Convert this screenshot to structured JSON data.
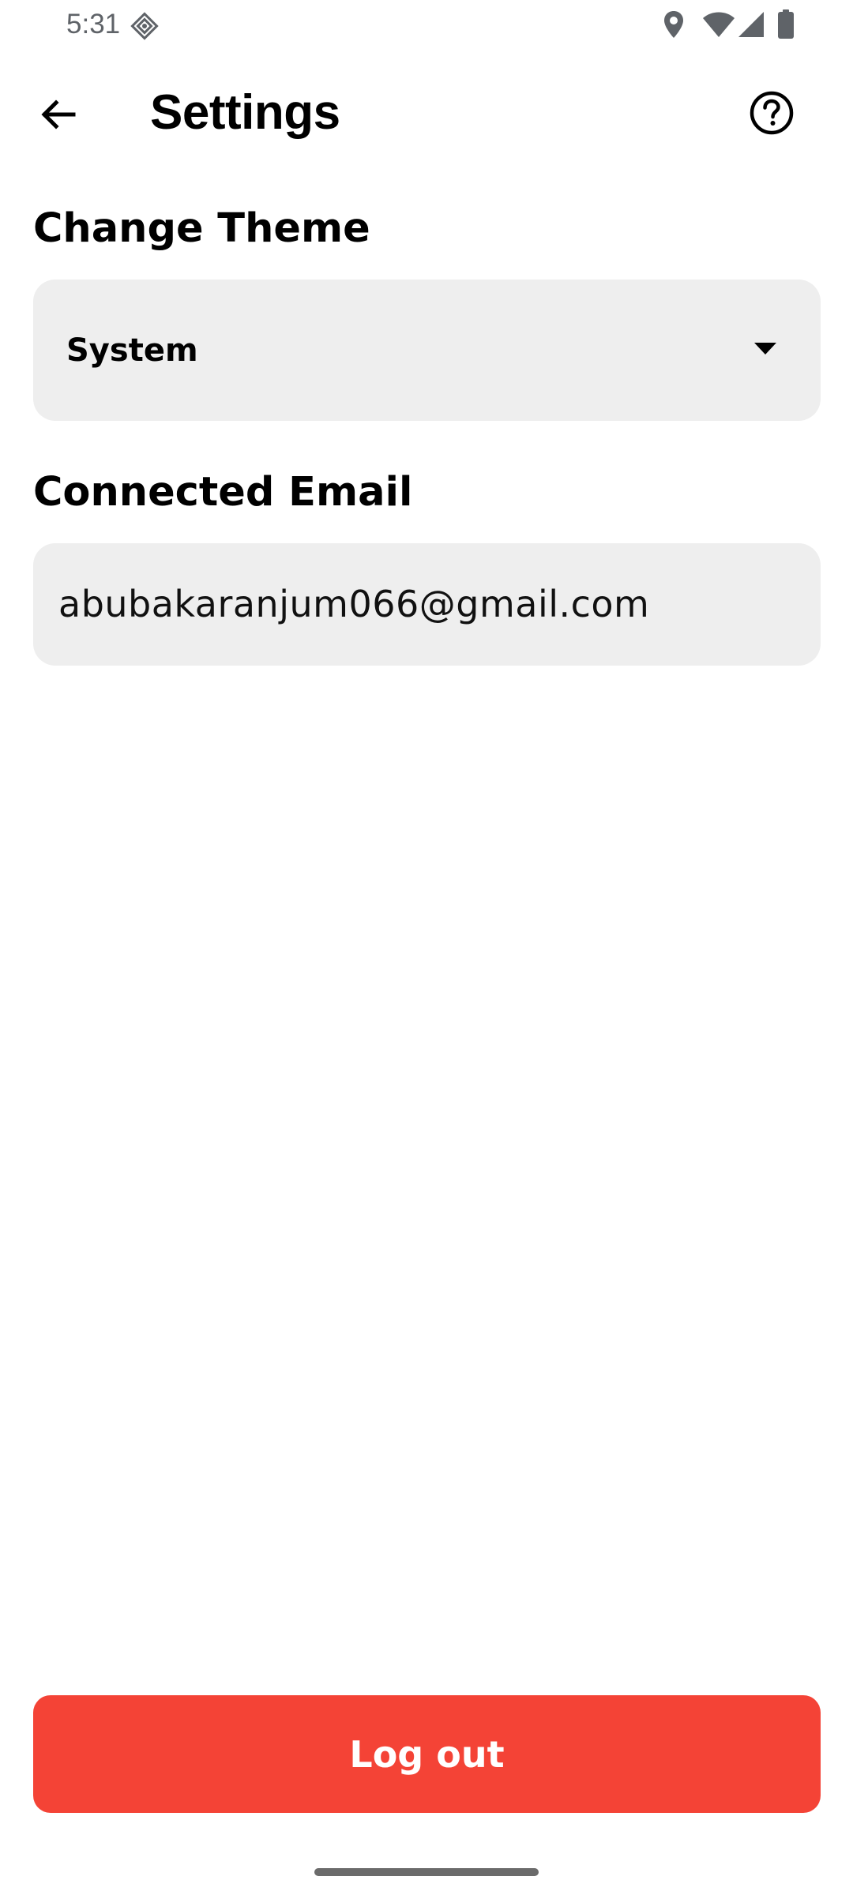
{
  "status_bar": {
    "time": "5:31",
    "icons": [
      "app-notification-icon",
      "location-icon",
      "wifi-icon",
      "signal-icon",
      "battery-icon"
    ]
  },
  "app_bar": {
    "title": "Settings",
    "back_icon": "arrow-back-icon",
    "help_icon": "help-circle-icon"
  },
  "theme_section": {
    "title": "Change Theme",
    "selected_value": "System",
    "dropdown_icon": "caret-down-icon"
  },
  "email_section": {
    "title": "Connected Email",
    "value": "abubakaranjum066@gmail.com"
  },
  "logout": {
    "label": "Log out"
  },
  "colors": {
    "background": "#ffffff",
    "field_background": "#eeeeee",
    "logout_button": "#f44336",
    "status_text": "#5f6368"
  }
}
